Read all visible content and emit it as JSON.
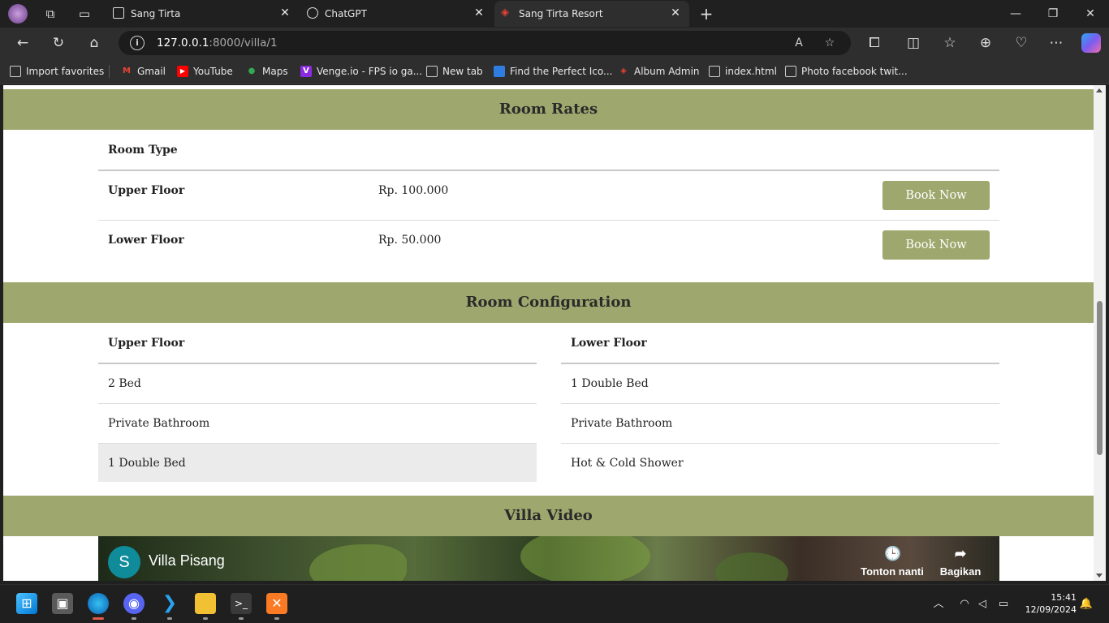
{
  "browser": {
    "tabs": [
      {
        "label": "Sang Tirta",
        "close": "✕"
      },
      {
        "label": "ChatGPT",
        "close": "✕"
      },
      {
        "label": "Sang Tirta Resort",
        "close": "✕"
      }
    ],
    "new_tab": "+",
    "window": {
      "minimize": "—",
      "maximize": "❐",
      "close": "✕"
    },
    "address": {
      "host": "127.0.0.1",
      "rest": ":8000/villa/1"
    },
    "favorites": [
      {
        "label": "Import favorites",
        "icon": "import-icon",
        "color": "#cccccc"
      },
      {
        "label": "Gmail",
        "icon": "gmail-icon",
        "color": "#ea4335"
      },
      {
        "label": "YouTube",
        "icon": "youtube-icon",
        "color": "#ff0000"
      },
      {
        "label": "Maps",
        "icon": "maps-icon",
        "color": "#34a853"
      },
      {
        "label": "Venge.io - FPS io ga...",
        "icon": "venge-icon",
        "color": "#8a2be2"
      },
      {
        "label": "New tab",
        "icon": "newtab-icon",
        "color": "#cccccc"
      },
      {
        "label": "Find the Perfect Ico...",
        "icon": "flag-icon",
        "color": "#2f7de1"
      },
      {
        "label": "Album Admin",
        "icon": "laravel-icon",
        "color": "#e34234"
      },
      {
        "label": "index.html",
        "icon": "file-icon",
        "color": "#cccccc"
      },
      {
        "label": "Photo facebook twit...",
        "icon": "file-icon",
        "color": "#cccccc"
      }
    ]
  },
  "page": {
    "room_rates": {
      "heading": "Room Rates",
      "col_header": "Room Type",
      "rows": [
        {
          "type": "Upper Floor",
          "price": "Rp. 100.000",
          "button": "Book Now"
        },
        {
          "type": "Lower Floor",
          "price": "Rp. 50.000",
          "button": "Book Now"
        }
      ]
    },
    "room_config": {
      "heading": "Room Configuration",
      "upper": {
        "title": "Upper Floor",
        "items": [
          "2 Bed",
          "Private Bathroom",
          "1 Double Bed"
        ]
      },
      "lower": {
        "title": "Lower Floor",
        "items": [
          "1 Double Bed",
          "Private Bathroom",
          "Hot & Cold Shower"
        ]
      }
    },
    "video": {
      "heading": "Villa Video",
      "channel_initial": "S",
      "title": "Villa Pisang",
      "watch_later": "Tonton nanti",
      "share": "Bagikan"
    }
  },
  "taskbar": {
    "time": "15:41",
    "date": "12/09/2024"
  },
  "colors": {
    "accent": "#9ea76d",
    "highlight_row": "#ebebeb"
  }
}
